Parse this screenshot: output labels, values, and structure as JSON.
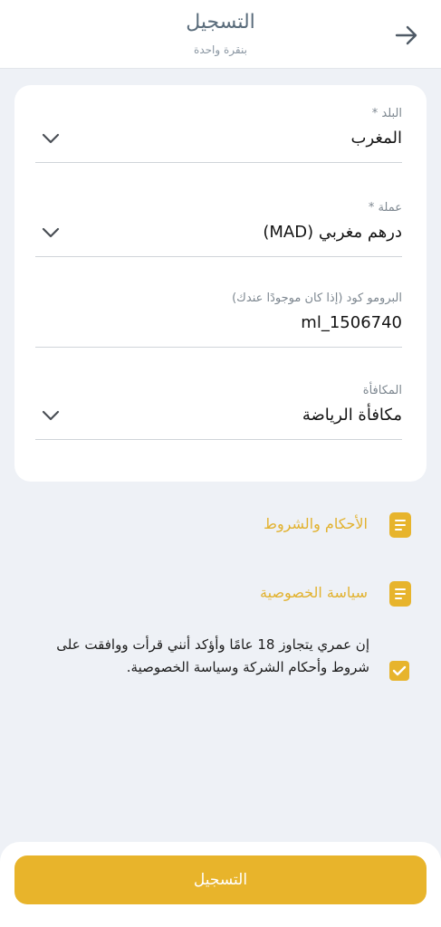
{
  "header": {
    "title": "التسجيل",
    "subtitle": "بنقرة واحدة",
    "back_icon": "arrow-right-icon"
  },
  "form": {
    "country": {
      "label": "البلد *",
      "value": "المغرب"
    },
    "currency": {
      "label": "عملة *",
      "value": "درهم مغربي (MAD)"
    },
    "promo": {
      "label": "البرومو كود (إذا كان موجودًا عندك)",
      "value": "ml_1506740"
    },
    "bonus": {
      "label": "المكافأة",
      "value": "مكافأة الرياضة"
    }
  },
  "links": {
    "terms": "الأحكام والشروط",
    "privacy": "سياسة الخصوصية"
  },
  "consent": {
    "text": "إن عمري يتجاوز 18 عامًا وأؤكد أنني قرأت ووافقت على شروط وأحكام الشركة وسياسة الخصوصية.",
    "checked": true
  },
  "submit": {
    "label": "التسجيل"
  },
  "colors": {
    "accent": "#e8b42b",
    "background": "#eef1f6",
    "title": "#5a6c7b"
  }
}
